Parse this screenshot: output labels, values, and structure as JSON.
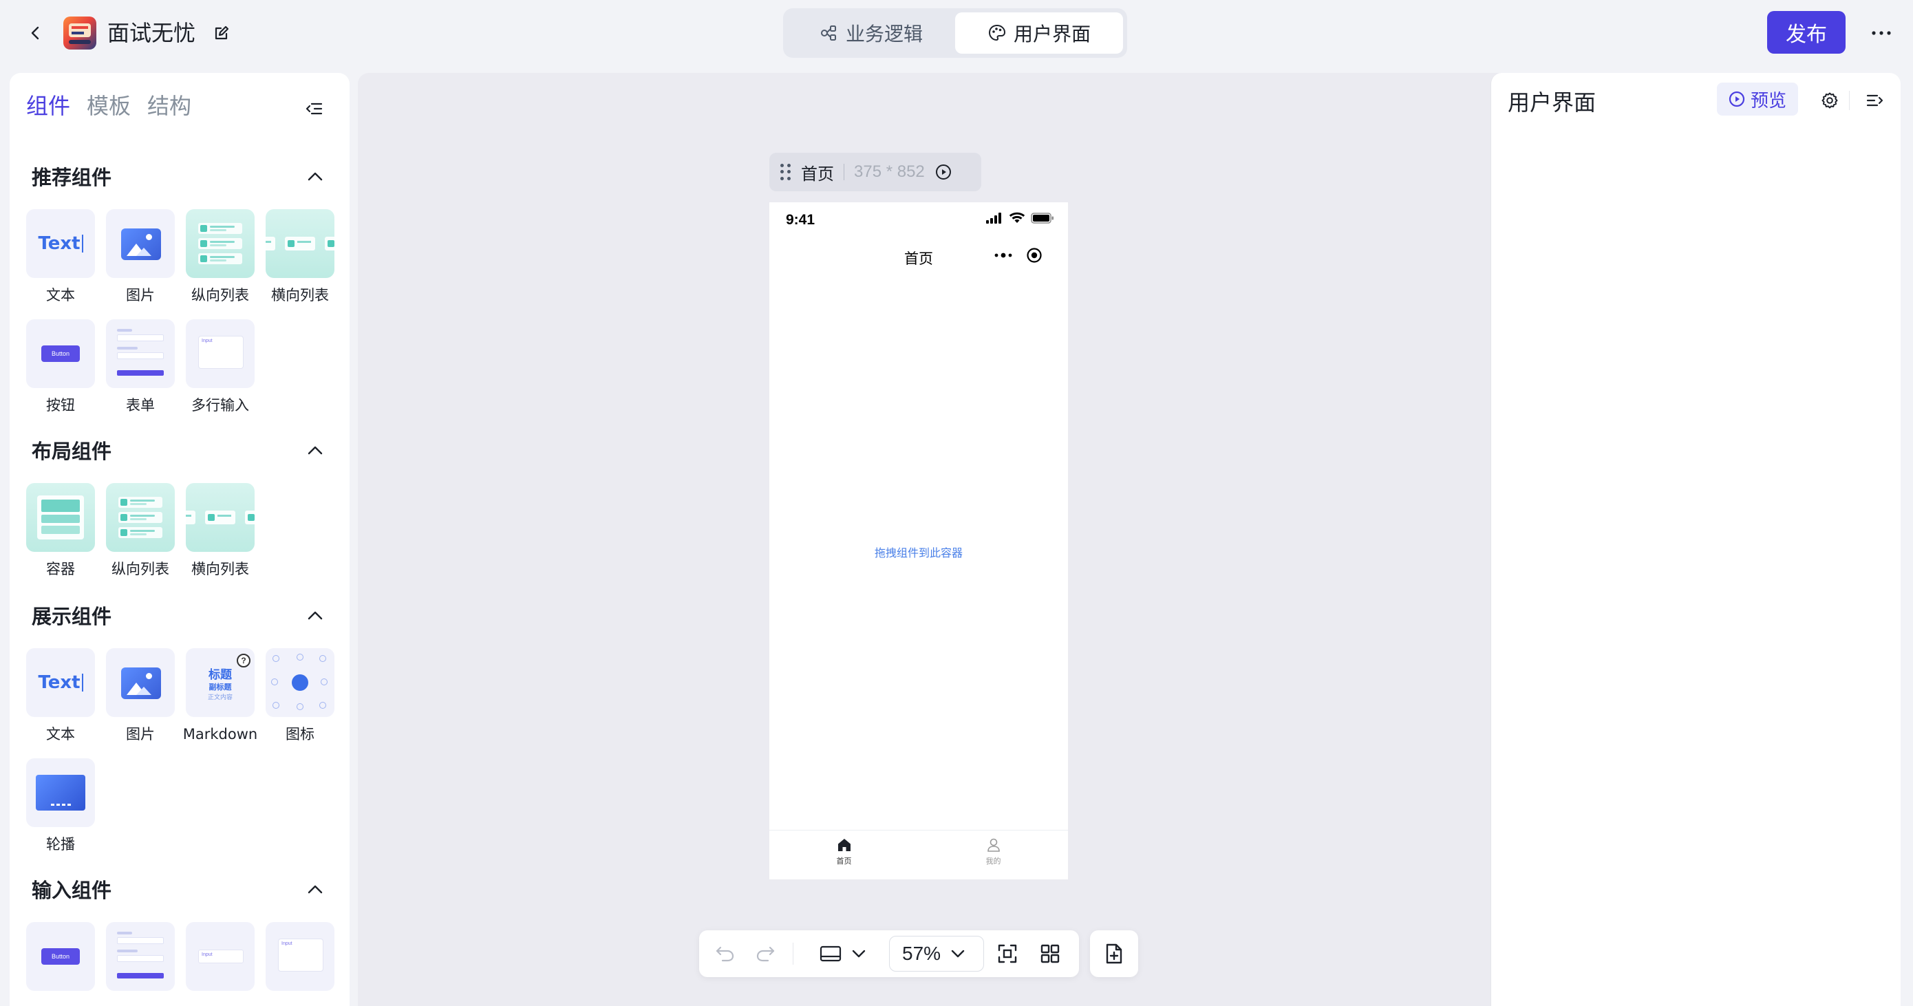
{
  "header": {
    "app_title": "面试无忧",
    "mode_tabs": [
      {
        "label": "业务逻辑",
        "icon": "flow-nodes-icon",
        "active": false
      },
      {
        "label": "用户界面",
        "icon": "palette-icon",
        "active": true
      }
    ],
    "publish_label": "发布"
  },
  "left_panel": {
    "tabs": [
      {
        "label": "组件",
        "active": true
      },
      {
        "label": "模板",
        "active": false
      },
      {
        "label": "结构",
        "active": false
      }
    ],
    "sections": [
      {
        "title": "推荐组件",
        "items": [
          {
            "label": "文本",
            "art": "text"
          },
          {
            "label": "图片",
            "art": "image"
          },
          {
            "label": "纵向列表",
            "art": "vertical-list"
          },
          {
            "label": "横向列表",
            "art": "horizontal-list"
          },
          {
            "label": "按钮",
            "art": "button"
          },
          {
            "label": "表单",
            "art": "form"
          },
          {
            "label": "多行输入",
            "art": "textarea"
          }
        ]
      },
      {
        "title": "布局组件",
        "items": [
          {
            "label": "容器",
            "art": "container"
          },
          {
            "label": "纵向列表",
            "art": "vertical-list"
          },
          {
            "label": "横向列表",
            "art": "horizontal-list"
          }
        ]
      },
      {
        "title": "展示组件",
        "items": [
          {
            "label": "文本",
            "art": "text"
          },
          {
            "label": "图片",
            "art": "image"
          },
          {
            "label": "Markdown",
            "art": "markdown"
          },
          {
            "label": "图标",
            "art": "icon"
          },
          {
            "label": "轮播",
            "art": "carousel"
          }
        ]
      },
      {
        "title": "输入组件",
        "items": [
          {
            "label": "",
            "art": "button"
          },
          {
            "label": "",
            "art": "form"
          },
          {
            "label": "",
            "art": "input"
          },
          {
            "label": "",
            "art": "textarea"
          }
        ]
      }
    ],
    "tile_text": {
      "text_sample": "Text",
      "button_sample": "Button",
      "input_placeholder": "Input",
      "md_title": "标题",
      "md_subtitle": "副标题",
      "md_body": "正文内容",
      "md_help": "?"
    }
  },
  "canvas": {
    "page_name": "首页",
    "page_size": "375 * 852",
    "phone": {
      "time": "9:41",
      "nav_title": "首页",
      "drop_hint": "拖拽组件到此容器",
      "tabbar": [
        {
          "label": "首页",
          "icon": "home-icon",
          "active": true
        },
        {
          "label": "我的",
          "icon": "user-icon",
          "active": false
        }
      ]
    },
    "zoom": "57%"
  },
  "right_panel": {
    "title": "用户界面",
    "preview_label": "预览"
  },
  "colors": {
    "accent": "#4a3ee0",
    "teal_tile": "#bdebe3",
    "hint_blue": "#4a80e8"
  }
}
